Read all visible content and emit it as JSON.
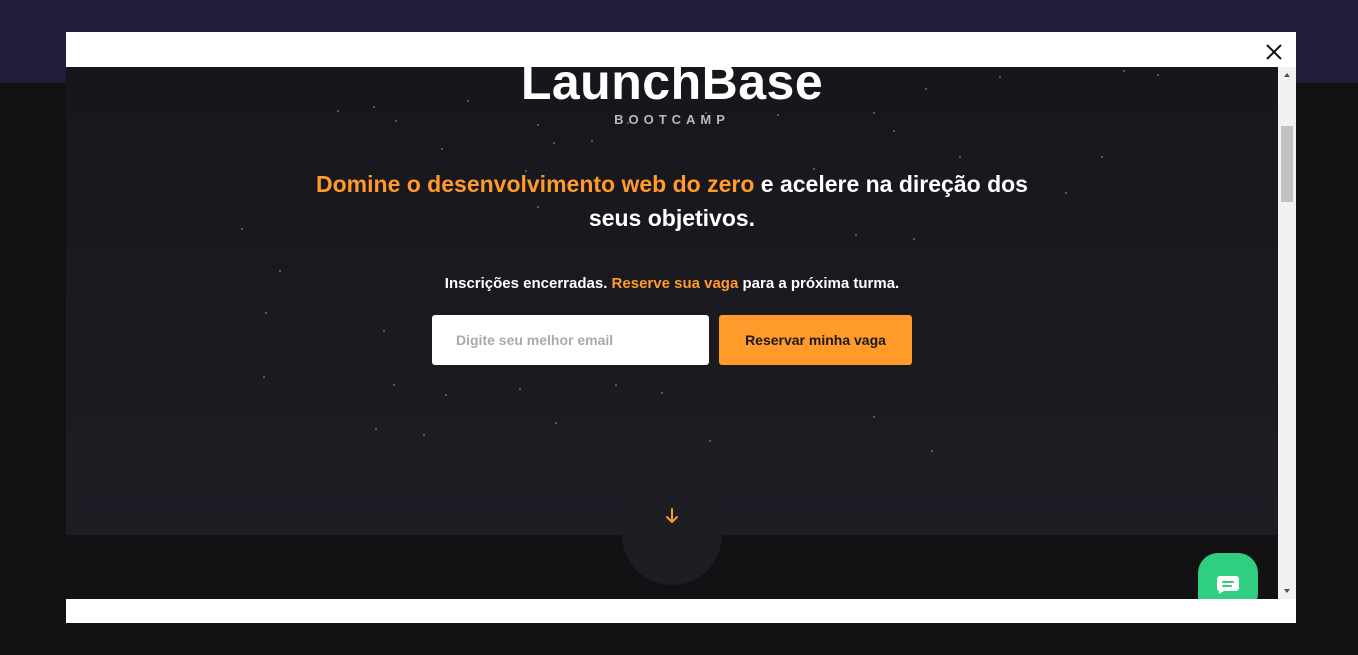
{
  "brand": {
    "logo": "LaunchBase",
    "sublogo": "BOOTCAMP"
  },
  "hero": {
    "headline_highlight": "Domine o desenvolvimento web do zero",
    "headline_rest": " e acelere na direção dos seus objetivos.",
    "notice_start": "Inscrições encerradas. ",
    "notice_highlight": "Reserve sua vaga",
    "notice_end": " para a próxima turma."
  },
  "form": {
    "email_placeholder": "Digite seu melhor email",
    "submit_label": "Reservar minha vaga"
  },
  "icons": {
    "close": "close-icon",
    "scroll_down": "arrow-down-icon",
    "chat": "chat-icon"
  },
  "colors": {
    "accent": "#ff9a2b",
    "chat": "#2fcf7f",
    "header": "#221c3a"
  }
}
